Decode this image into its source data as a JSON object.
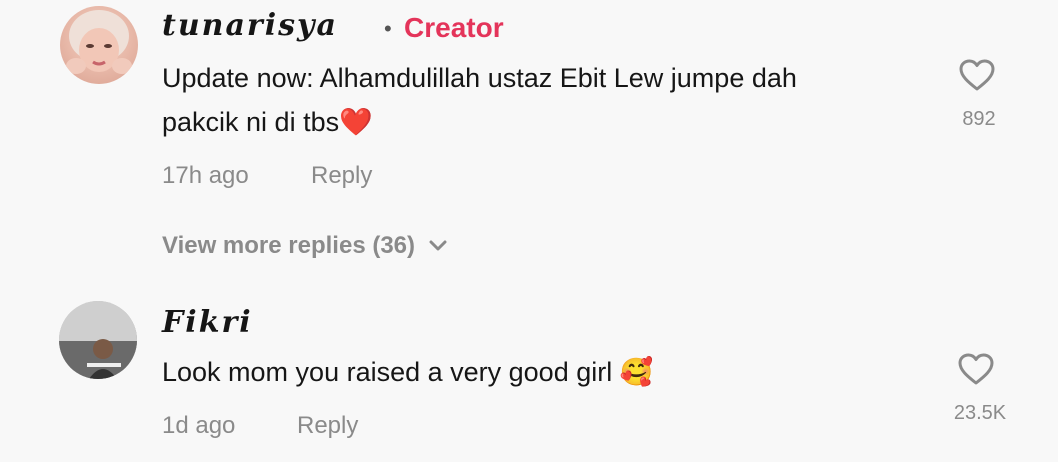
{
  "comments": [
    {
      "username": "tunarisya",
      "badge": "Creator",
      "text_line1": "Update now: Alhamdulillah ustaz Ebit Lew jumpe dah",
      "text_line2": "pakcik ni di tbs",
      "emoji": "❤️",
      "time": "17h ago",
      "reply_label": "Reply",
      "likes": "892"
    },
    {
      "username": "Fikri",
      "text_line1": "Look mom you raised a very good girl",
      "emoji": "🥰",
      "time": "1d ago",
      "reply_label": "Reply",
      "likes": "23.5K"
    }
  ],
  "view_more": "View more replies (36)",
  "icons": {
    "like": "heart-outline-icon",
    "expand": "chevron-down-icon"
  },
  "colors": {
    "creator_badge": "#e4345a",
    "muted_text": "#8a8a8a",
    "background": "#f8f8f8"
  }
}
